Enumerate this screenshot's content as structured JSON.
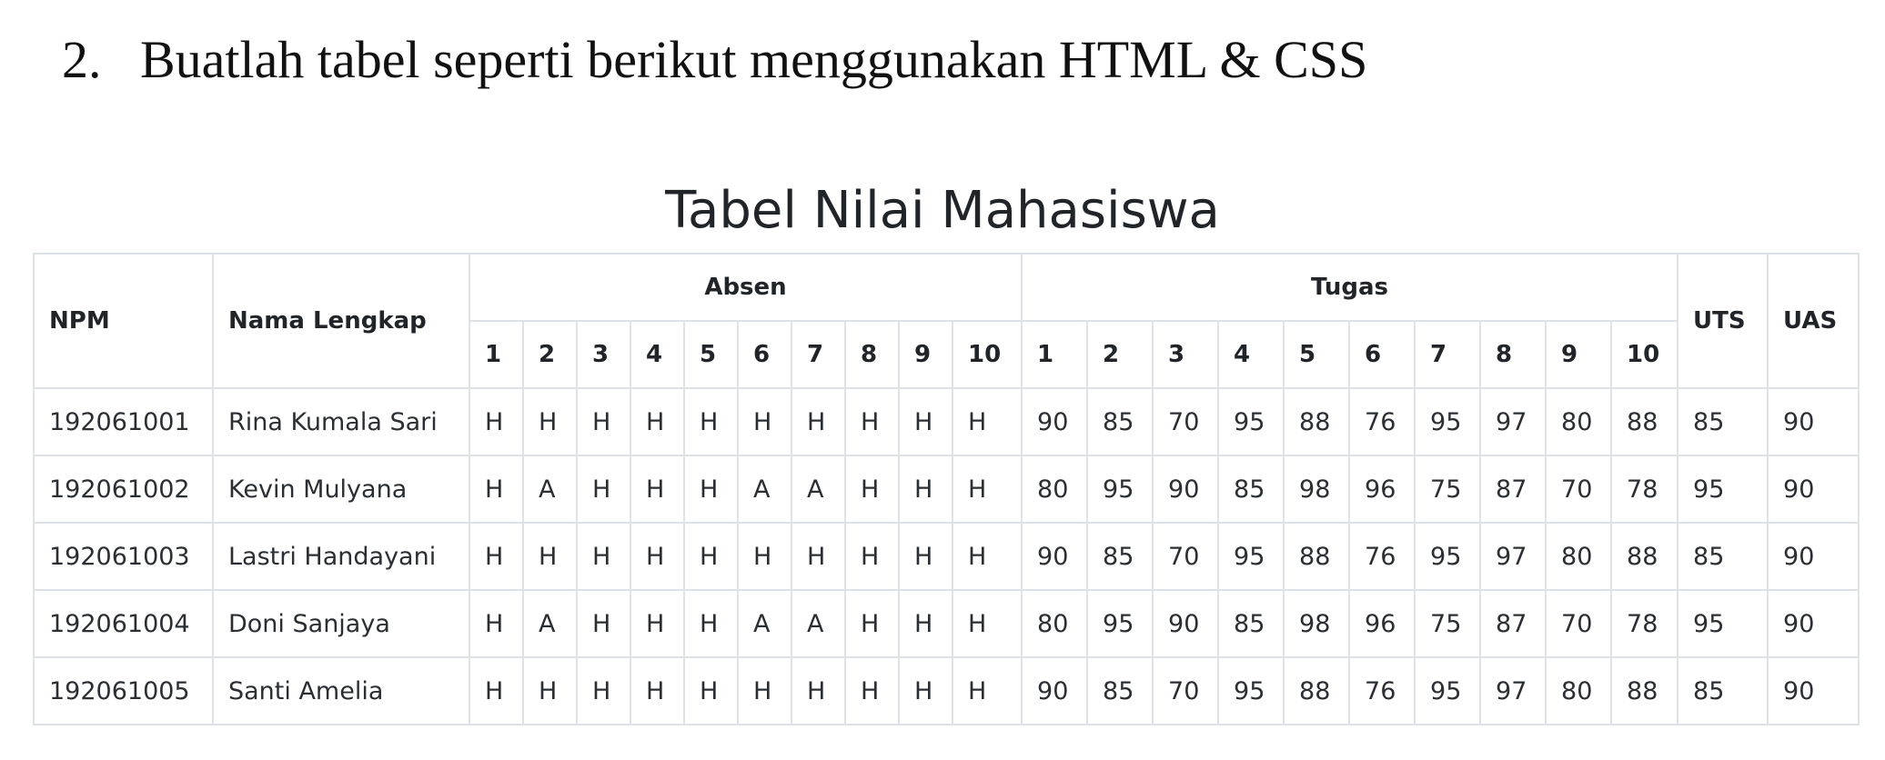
{
  "instruction": {
    "number": "2.",
    "text": "Buatlah tabel seperti berikut menggunakan HTML & CSS"
  },
  "table": {
    "title": "Tabel Nilai Mahasiswa",
    "headers": {
      "npm": "NPM",
      "nama": "Nama Lengkap",
      "absen": "Absen",
      "tugas": "Tugas",
      "uts": "UTS",
      "uas": "UAS"
    },
    "absen_numbers": [
      "1",
      "2",
      "3",
      "4",
      "5",
      "6",
      "7",
      "8",
      "9",
      "10"
    ],
    "tugas_numbers": [
      "1",
      "2",
      "3",
      "4",
      "5",
      "6",
      "7",
      "8",
      "9",
      "10"
    ],
    "rows": [
      {
        "npm": "192061001",
        "nama": "Rina Kumala Sari",
        "absen": [
          "H",
          "H",
          "H",
          "H",
          "H",
          "H",
          "H",
          "H",
          "H",
          "H"
        ],
        "tugas": [
          "90",
          "85",
          "70",
          "95",
          "88",
          "76",
          "95",
          "97",
          "80",
          "88"
        ],
        "uts": "85",
        "uas": "90"
      },
      {
        "npm": "192061002",
        "nama": "Kevin Mulyana",
        "absen": [
          "H",
          "A",
          "H",
          "H",
          "H",
          "A",
          "A",
          "H",
          "H",
          "H"
        ],
        "tugas": [
          "80",
          "95",
          "90",
          "85",
          "98",
          "96",
          "75",
          "87",
          "70",
          "78"
        ],
        "uts": "95",
        "uas": "90"
      },
      {
        "npm": "192061003",
        "nama": "Lastri Handayani",
        "absen": [
          "H",
          "H",
          "H",
          "H",
          "H",
          "H",
          "H",
          "H",
          "H",
          "H"
        ],
        "tugas": [
          "90",
          "85",
          "70",
          "95",
          "88",
          "76",
          "95",
          "97",
          "80",
          "88"
        ],
        "uts": "85",
        "uas": "90"
      },
      {
        "npm": "192061004",
        "nama": "Doni Sanjaya",
        "absen": [
          "H",
          "A",
          "H",
          "H",
          "H",
          "A",
          "A",
          "H",
          "H",
          "H"
        ],
        "tugas": [
          "80",
          "95",
          "90",
          "85",
          "98",
          "96",
          "75",
          "87",
          "70",
          "78"
        ],
        "uts": "95",
        "uas": "90"
      },
      {
        "npm": "192061005",
        "nama": "Santi Amelia",
        "absen": [
          "H",
          "H",
          "H",
          "H",
          "H",
          "H",
          "H",
          "H",
          "H",
          "H"
        ],
        "tugas": [
          "90",
          "85",
          "70",
          "95",
          "88",
          "76",
          "95",
          "97",
          "80",
          "88"
        ],
        "uts": "85",
        "uas": "90"
      }
    ]
  }
}
